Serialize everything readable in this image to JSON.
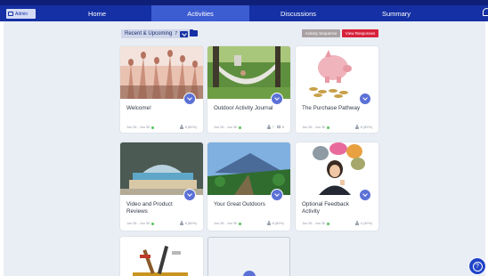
{
  "nav": {
    "admin_label": "Admin",
    "tabs": [
      {
        "label": "Home",
        "active": false
      },
      {
        "label": "Activities",
        "active": true
      },
      {
        "label": "Discussions",
        "active": false
      },
      {
        "label": "Summary",
        "active": false
      }
    ]
  },
  "toolbar": {
    "filter_label": "Recent & Upcoming",
    "filter_count": "7",
    "activity_sequence_label": "Activity Sequence",
    "view_responses_label": "View Responses"
  },
  "cards": [
    {
      "title": "Welcome!",
      "date": "Jun 26 - Jun 30",
      "stat": "8 (80%)",
      "comments": ""
    },
    {
      "title": "Outdoor Activity Journal",
      "date": "Jun 26 - Jun 30",
      "stat": "7",
      "comments": "8"
    },
    {
      "title": "The Purchase Pathway",
      "date": "Jun 26 - Jun 30",
      "stat": "8 (80%)",
      "comments": ""
    },
    {
      "title": "Video and Product Reviews",
      "date": "Jun 26 - Jun 30",
      "stat": "8 (80%)",
      "comments": ""
    },
    {
      "title": "Your Great Outdoors",
      "date": "Jun 26 - Jun 30",
      "stat": "8 (80%)",
      "comments": ""
    },
    {
      "title": "Optional Feedback Activity",
      "date": "Jun 26 - Jun 30",
      "stat": "4 (40%)",
      "comments": ""
    }
  ],
  "colors": {
    "nav": "#1530a4",
    "nav_active": "#3c5cd2",
    "accent": "#5b71d6",
    "danger": "#d8203b",
    "status_active": "#57c25b"
  },
  "help": {
    "label": "?"
  }
}
